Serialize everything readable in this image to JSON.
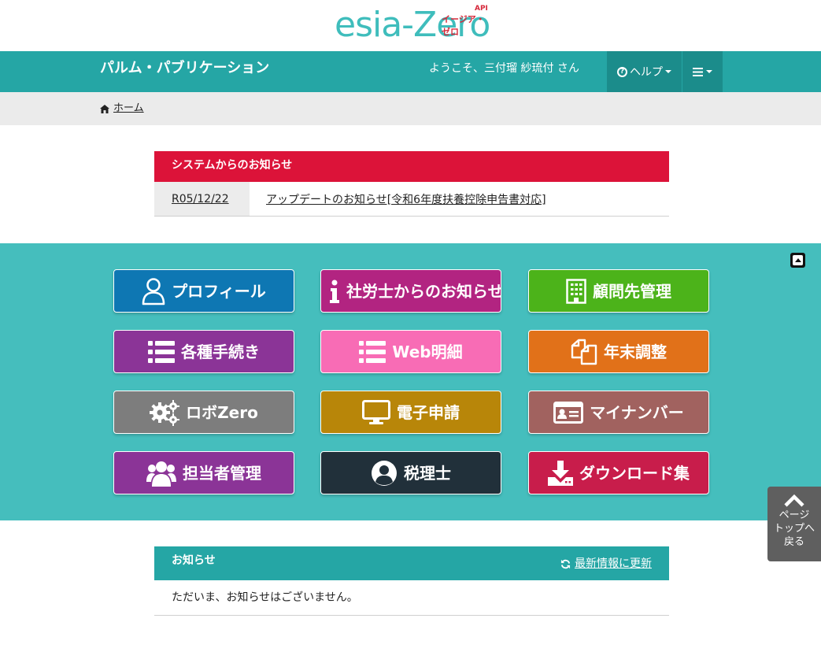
{
  "logo": {
    "main": "esia-Zero",
    "sub": "イージア・ゼロ",
    "api": "API"
  },
  "header": {
    "brand": "パルム・パブリケーション",
    "welcome": "ようこそ、三付瑠 紗琉付 さん",
    "help_label": "ヘルプ"
  },
  "breadcrumb": {
    "home": "ホーム"
  },
  "system_notices": {
    "title": "システムからのお知らせ",
    "items": [
      {
        "date": "R05/12/22",
        "title": "アップデートのお知らせ[令和6年度扶養控除申告書対応]"
      }
    ]
  },
  "tiles": [
    {
      "label": "プロフィール",
      "icon": "user-icon",
      "color": "#0e77b3"
    },
    {
      "label": "社労士からのお知らせ",
      "icon": "info-icon",
      "color": "#b22481"
    },
    {
      "label": "顧問先管理",
      "icon": "building-icon",
      "color": "#4cb31a"
    },
    {
      "label": "各種手続き",
      "icon": "list-icon",
      "color": "#8b3497"
    },
    {
      "label": "Web明細",
      "icon": "list-icon",
      "color": "#f86cb5"
    },
    {
      "label": "年末調整",
      "icon": "copy-icon",
      "color": "#e17119"
    },
    {
      "label": "ロボZero",
      "icon": "gears-icon",
      "color": "#7d7d7d"
    },
    {
      "label": "電子申請",
      "icon": "monitor-icon",
      "color": "#b88609"
    },
    {
      "label": "マイナンバー",
      "icon": "id-card-icon",
      "color": "#a1625f"
    },
    {
      "label": "担当者管理",
      "icon": "users-icon",
      "color": "#8b3497"
    },
    {
      "label": "税理士",
      "icon": "user-circle-icon",
      "color": "#21303a"
    },
    {
      "label": "ダウンロード集",
      "icon": "download-icon",
      "color": "#c81d4b"
    }
  ],
  "news": {
    "title": "お知らせ",
    "refresh_label": "最新情報に更新",
    "empty_message": "ただいま、お知らせはございません。"
  },
  "back_to_top": {
    "line1": "ページ",
    "line2": "トップへ",
    "line3": "戻る"
  }
}
